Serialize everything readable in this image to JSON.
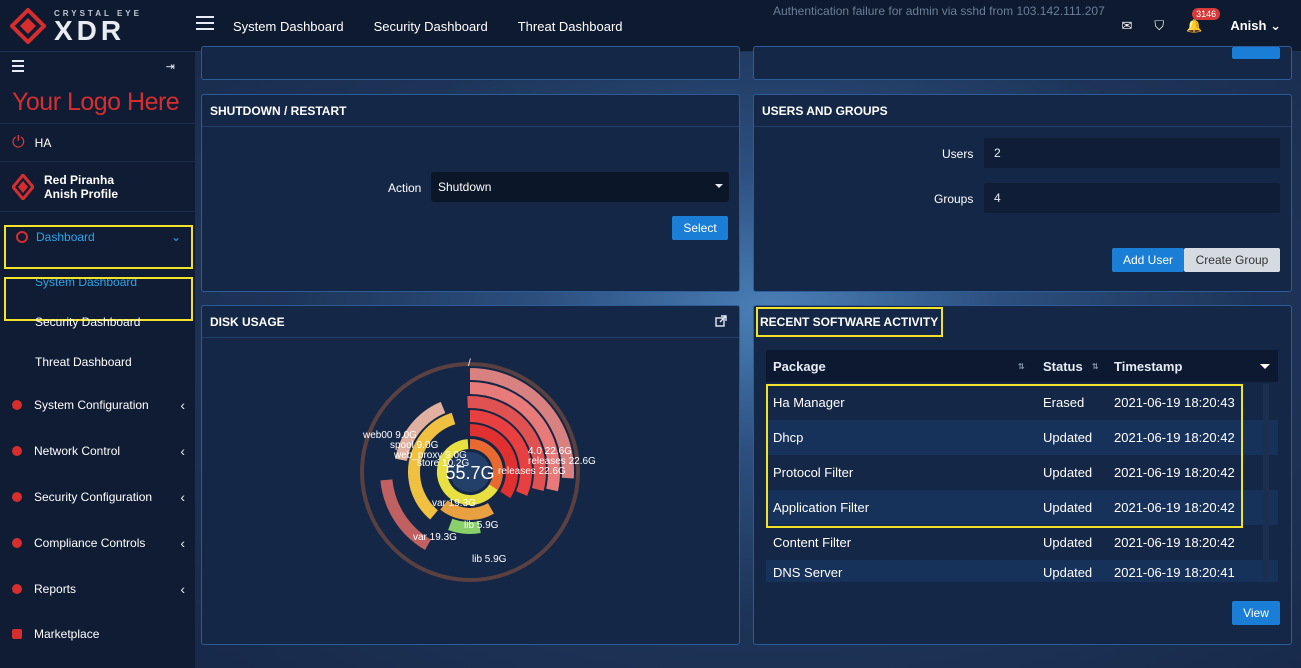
{
  "brand": {
    "sub": "CRYSTAL EYE",
    "main": "XDR"
  },
  "topnav": [
    "System Dashboard",
    "Security Dashboard",
    "Threat Dashboard"
  ],
  "topbar": {
    "notification_count": "3146",
    "user": "Anish"
  },
  "sidebar": {
    "logo_text": "Your Logo Here",
    "ha_label": "HA",
    "profile_name": "Red Piranha",
    "profile_sub": "Anish Profile",
    "dashboard_label": "Dashboard",
    "sub_items": [
      "System Dashboard",
      "Security Dashboard",
      "Threat Dashboard"
    ],
    "sections": [
      "System Configuration",
      "Network Control",
      "Security Configuration",
      "Compliance Controls",
      "Reports",
      "Marketplace"
    ]
  },
  "top_partial": {
    "text": "Authentication failure for admin via sshd from 103.142.111.207"
  },
  "shutdown": {
    "title": "SHUTDOWN / RESTART",
    "action_label": "Action",
    "action_value": "Shutdown",
    "select_button": "Select"
  },
  "users_groups": {
    "title": "USERS AND GROUPS",
    "users_label": "Users",
    "users_value": "2",
    "groups_label": "Groups",
    "groups_value": "4",
    "add_user": "Add User",
    "create_group": "Create Group"
  },
  "disk": {
    "title": "DISK USAGE",
    "center_value": "55.7G",
    "root_label": "/",
    "labels": [
      "web00 9.0G",
      "spool 9.0G",
      "web_proxy 9.0G",
      "store 10.2G",
      "4.0 22.6G",
      "releases 22.6G",
      "releases 22.6G",
      "var 19.3G",
      "lib 5.9G",
      "var 19.3G",
      "lib 5.9G"
    ]
  },
  "software": {
    "title": "RECENT SOFTWARE ACTIVITY",
    "columns": [
      "Package",
      "Status",
      "Timestamp"
    ],
    "rows": [
      {
        "package": "Ha Manager",
        "status": "Erased",
        "timestamp": "2021-06-19 18:20:43"
      },
      {
        "package": "Dhcp",
        "status": "Updated",
        "timestamp": "2021-06-19 18:20:42"
      },
      {
        "package": "Protocol Filter",
        "status": "Updated",
        "timestamp": "2021-06-19 18:20:42"
      },
      {
        "package": "Application Filter",
        "status": "Updated",
        "timestamp": "2021-06-19 18:20:42"
      },
      {
        "package": "Content Filter",
        "status": "Updated",
        "timestamp": "2021-06-19 18:20:42"
      },
      {
        "package": "DNS Server",
        "status": "Updated",
        "timestamp": "2021-06-19 18:20:41"
      }
    ],
    "view_button": "View"
  },
  "colors": {
    "accent": "#1a7ed6",
    "highlight": "#f2e32a",
    "brand_red": "#d62e2e"
  }
}
